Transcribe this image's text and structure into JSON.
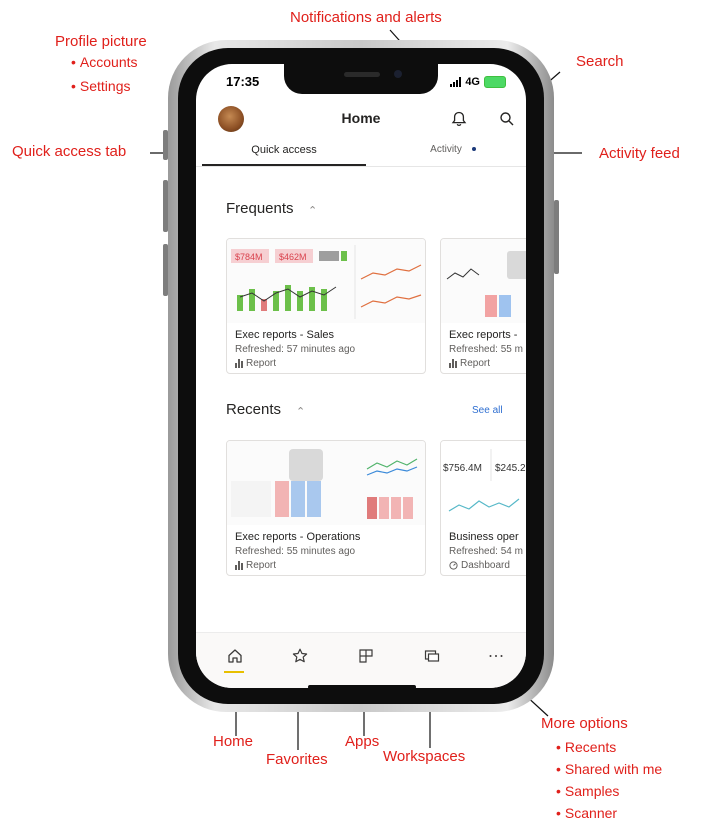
{
  "annotations": {
    "profile_picture": "Profile picture",
    "profile_items": [
      "Accounts",
      "Settings"
    ],
    "notifications": "Notifications and alerts",
    "search": "Search",
    "quick_access_tab": "Quick access tab",
    "activity_feed": "Activity feed",
    "home": "Home",
    "favorites": "Favorites",
    "apps": "Apps",
    "workspaces": "Workspaces",
    "more_options": "More options",
    "more_items": [
      "Recents",
      "Shared with me",
      "Samples",
      "Scanner"
    ]
  },
  "status_bar": {
    "time": "17:35",
    "network": "4G"
  },
  "header": {
    "title": "Home"
  },
  "tabs": [
    {
      "label": "Quick access",
      "active": true
    },
    {
      "label": "Activity",
      "active": false
    }
  ],
  "frequents": {
    "title": "Frequents",
    "cards": [
      {
        "title": "Exec reports - Sales",
        "subtitle": "Refreshed: 57 minutes ago",
        "type": "Report",
        "thumb_kpis": [
          "$784M",
          "$462M"
        ]
      },
      {
        "title": "Exec reports -",
        "subtitle": "Refreshed: 55 m",
        "type": "Report"
      }
    ]
  },
  "recents": {
    "title": "Recents",
    "see_all": "See all",
    "cards": [
      {
        "title": "Exec reports - Operations",
        "subtitle": "Refreshed: 55 minutes ago",
        "type": "Report"
      },
      {
        "title": "Business oper",
        "subtitle": "Refreshed: 54 m",
        "type": "Dashboard",
        "thumb_kpis": [
          "$756.4M",
          "$245.2M"
        ]
      }
    ]
  },
  "nav": [
    {
      "name": "home",
      "icon": "home-icon",
      "active": true
    },
    {
      "name": "favorites",
      "icon": "star-icon"
    },
    {
      "name": "apps",
      "icon": "apps-icon"
    },
    {
      "name": "workspaces",
      "icon": "workspaces-icon"
    },
    {
      "name": "more",
      "icon": "more-icon"
    }
  ],
  "colors": {
    "annotation": "#e0201b",
    "accent": "#2f6fd1",
    "home_indicator": "#e8c000"
  }
}
